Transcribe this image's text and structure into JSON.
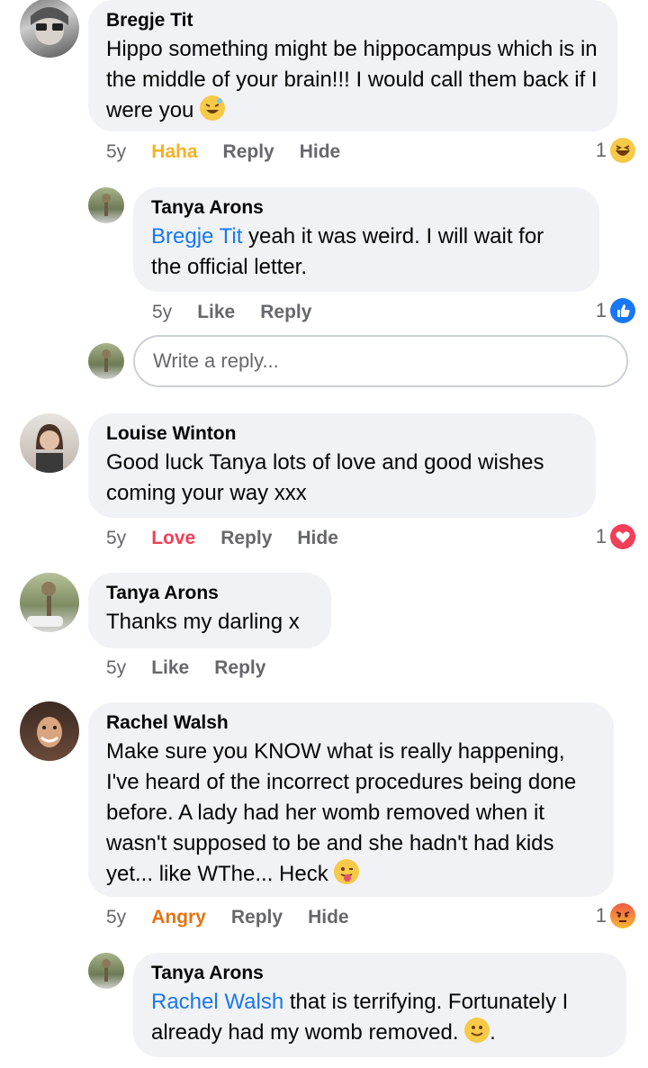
{
  "comments": [
    {
      "author": "Bregje Tit",
      "text": "Hippo something might be hippocampus which is in the middle of your brain!!! I would call them back if I were you",
      "time": "5y",
      "reaction_label": "Haha",
      "reply": "Reply",
      "hide": "Hide",
      "count": "1",
      "reaction_icon": "haha-emoji-icon"
    },
    {
      "author": "Tanya Arons",
      "mention": "Bregje Tit",
      "text": " yeah it was weird.  I will wait for the official letter.",
      "time": "5y",
      "like": "Like",
      "reply": "Reply",
      "count": "1",
      "reaction_icon": "like-icon"
    },
    {
      "author": "Louise Winton",
      "text": "Good luck Tanya lots of love and good wishes coming your way xxx",
      "time": "5y",
      "reaction_label": "Love",
      "reply": "Reply",
      "hide": "Hide",
      "count": "1",
      "reaction_icon": "love-icon"
    },
    {
      "author": "Tanya Arons",
      "text": "Thanks my darling x",
      "time": "5y",
      "like": "Like",
      "reply": "Reply"
    },
    {
      "author": "Rachel Walsh",
      "text": "Make sure you KNOW what is really happening, I've heard of the incorrect procedures being done before. A lady had her womb removed when it wasn't supposed to be and she hadn't had kids yet... like WThe... Heck",
      "time": "5y",
      "reaction_label": "Angry",
      "reply": "Reply",
      "hide": "Hide",
      "count": "1",
      "reaction_icon": "angry-emoji-icon"
    },
    {
      "author": "Tanya Arons",
      "mention": "Rachel Walsh",
      "text": " that is terrifying.  Fortunately I already had my womb removed.",
      "text_end": "."
    }
  ],
  "reply_box": {
    "placeholder": "Write a reply..."
  },
  "colors": {
    "bubble": "#f0f2f5",
    "mention": "#1877f2",
    "haha": "#f7b125",
    "love": "#f33e58",
    "angry": "#e9710f",
    "meta": "#65676b"
  }
}
